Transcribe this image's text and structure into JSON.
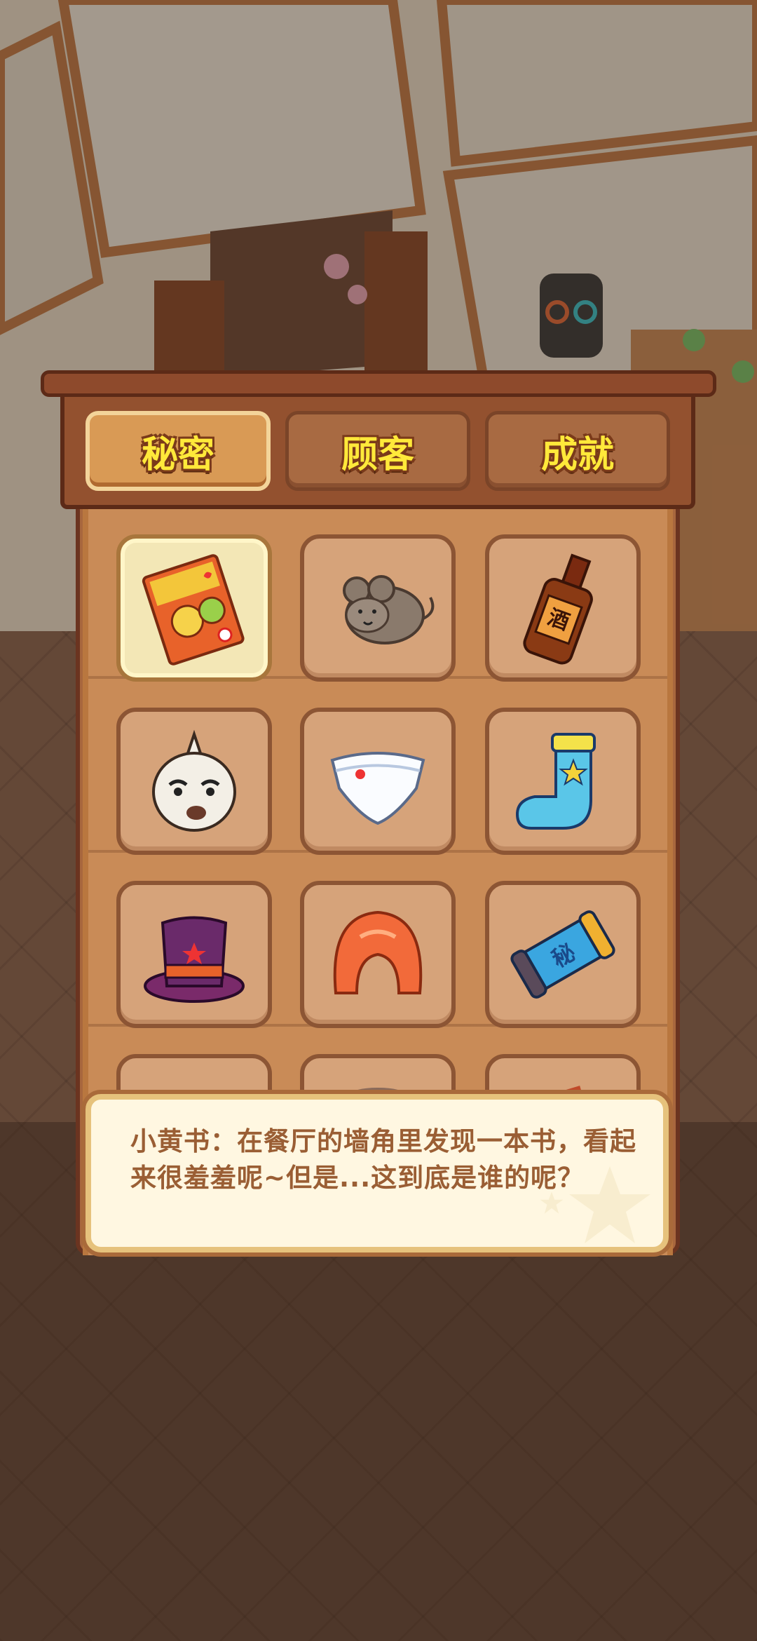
{
  "tabs": [
    {
      "label": "秘密",
      "active": true
    },
    {
      "label": "顾客",
      "active": false
    },
    {
      "label": "成就",
      "active": false
    }
  ],
  "items": [
    {
      "icon": "adult-book-icon",
      "selected": true
    },
    {
      "icon": "mouse-icon",
      "selected": false
    },
    {
      "icon": "liquor-bottle-icon",
      "selected": false
    },
    {
      "icon": "garlic-face-icon",
      "selected": false
    },
    {
      "icon": "underwear-icon",
      "selected": false
    },
    {
      "icon": "sock-icon",
      "selected": false
    },
    {
      "icon": "top-hat-icon",
      "selected": false
    },
    {
      "icon": "orange-wig-icon",
      "selected": false
    },
    {
      "icon": "scroll-icon",
      "selected": false
    },
    {
      "icon": "hidden-item-icon",
      "selected": false
    },
    {
      "icon": "hidden-item-icon",
      "selected": false
    },
    {
      "icon": "hidden-item-icon",
      "selected": false
    }
  ],
  "description": {
    "text": "小黄书：在餐厅的墙角里发现一本书，看起来很羞羞呢~但是...这到底是谁的呢？"
  },
  "colors": {
    "tab_text": "#ffe93a",
    "panel": "#a8673e",
    "slot": "#d6a37a",
    "slot_selected": "#f3e7b6",
    "description_text": "#9a5e34"
  }
}
